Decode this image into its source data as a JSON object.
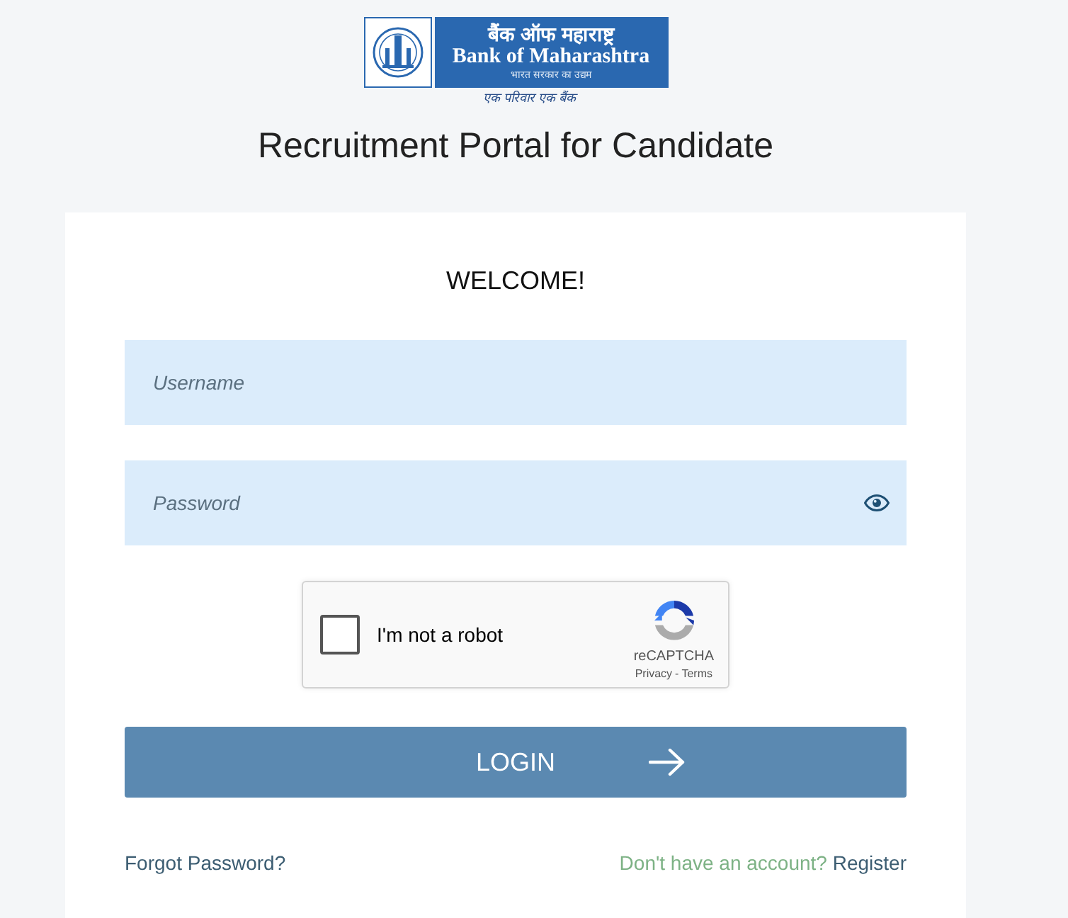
{
  "header": {
    "logo": {
      "hindi_name": "बैंक ऑफ महाराष्ट्र",
      "english_name": "Bank of Maharashtra",
      "subtitle": "भारत सरकार का उद्यम",
      "tagline": "एक परिवार एक बैंक"
    },
    "title": "Recruitment Portal for Candidate"
  },
  "login_card": {
    "heading": "WELCOME!",
    "fields": [
      {
        "kind": "text",
        "placeholder": "Username"
      },
      {
        "kind": "password",
        "placeholder": "Password"
      }
    ],
    "captcha": {
      "label": "I'm not a robot",
      "checked": false,
      "brand": "reCAPTCHA",
      "links": [
        "Privacy",
        "Terms"
      ],
      "separator": "-"
    },
    "login_button": "LOGIN",
    "forgot_link": "Forgot Password?",
    "register_prompt": "Don't have an account?",
    "register_link": "Register"
  }
}
